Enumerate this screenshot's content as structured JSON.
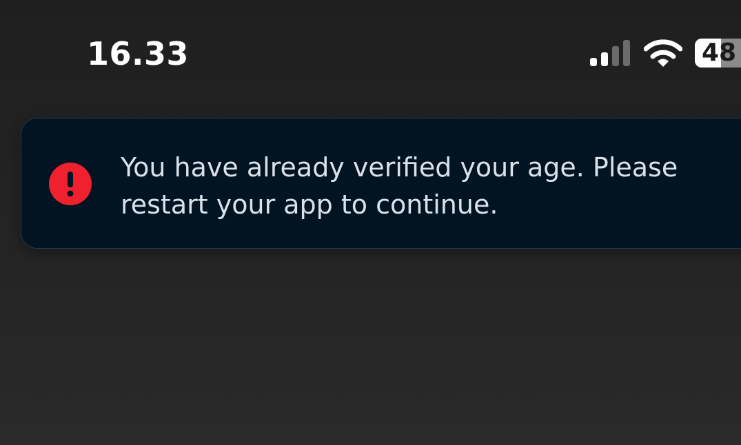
{
  "status_bar": {
    "time": "16.33",
    "battery_level": "48",
    "battery_fraction": 0.48,
    "signal_bars_active": 2,
    "signal_bars_total": 4
  },
  "toast": {
    "icon": "exclamation-circle-icon",
    "message": "You have already verified your age. Please restart your app to continue.",
    "icon_color": "#f0212e",
    "background_color": "#021321"
  }
}
